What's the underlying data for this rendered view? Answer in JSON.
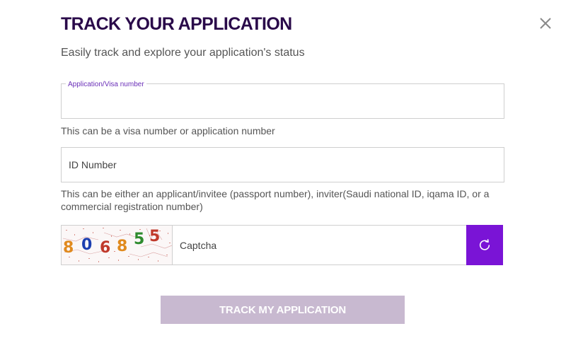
{
  "dialog": {
    "title": "TRACK YOUR APPLICATION",
    "subtitle": "Easily track and explore your application's status"
  },
  "icons": {
    "close": "close-icon",
    "refresh": "refresh-icon"
  },
  "fields": {
    "application": {
      "label": "Application/Visa number",
      "value": "",
      "hint": "This can be a visa number or application number"
    },
    "id_number": {
      "placeholder": "ID Number",
      "value": "",
      "hint": "This can be either an applicant/invitee (passport number), inviter(Saudi national ID, iqama ID, or a commercial registration number)"
    },
    "captcha": {
      "placeholder": "Captcha",
      "value": "",
      "image_text": "806855"
    }
  },
  "submit": {
    "label": "TRACK MY APPLICATION",
    "disabled": true
  },
  "colors": {
    "title": "#2a0a4a",
    "accent": "#7a14d6",
    "label_accent": "#6a2fb8",
    "button_disabled": "#c8b9d0"
  }
}
